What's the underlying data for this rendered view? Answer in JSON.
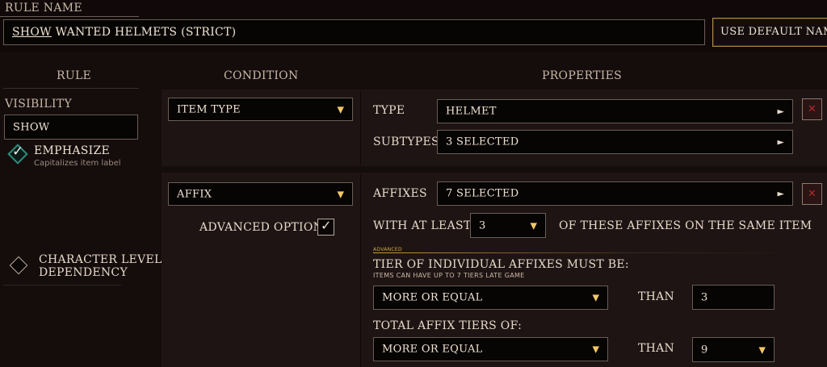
{
  "rule_name": {
    "label": "RULE NAME",
    "value_prefix": "SHOW",
    "value_rest": " WANTED HELMETS (STRICT)",
    "default_button": "USE DEFAULT NAME"
  },
  "columns": {
    "rule": "RULE",
    "condition": "CONDITION",
    "properties": "PROPERTIES"
  },
  "sidebar": {
    "visibility_label": "VISIBILITY",
    "visibility_value": "SHOW",
    "emphasize_label": "EMPHASIZE",
    "emphasize_hint": "Capitalizes item label",
    "char_level_line1": "CHARACTER LEVEL",
    "char_level_line2": "DEPENDENCY"
  },
  "condition1": {
    "type_select": "ITEM TYPE",
    "type_label": "TYPE",
    "type_value": "HELMET",
    "subtypes_label": "SUBTYPES",
    "subtypes_value": "3 SELECTED"
  },
  "condition2": {
    "type_select": "AFFIX",
    "advanced_options": "ADVANCED OPTIONS",
    "affixes_label": "AFFIXES",
    "affixes_value": "7 SELECTED",
    "with_at_least": "WITH AT LEAST",
    "count_value": "3",
    "same_item": "OF THESE AFFIXES ON THE SAME ITEM",
    "advanced_tag": "ADVANCED",
    "tier_label": "TIER OF INDIVIDUAL AFFIXES MUST BE:",
    "tier_hint": "ITEMS CAN HAVE UP TO 7 TIERS LATE GAME",
    "tier_compare": "MORE OR EQUAL",
    "than1": "THAN",
    "tier_value": "3",
    "total_label": "TOTAL AFFIX TIERS OF:",
    "total_compare": "MORE OR EQUAL",
    "than2": "THAN",
    "total_value": "9"
  },
  "icons": {
    "dropdown": "▼",
    "arrow_right": "►",
    "close": "✕",
    "check": "✓"
  },
  "colors": {
    "accent_gold": "#f2c866",
    "close_red": "#b22a2a",
    "check_teal": "#2e8b7a"
  }
}
